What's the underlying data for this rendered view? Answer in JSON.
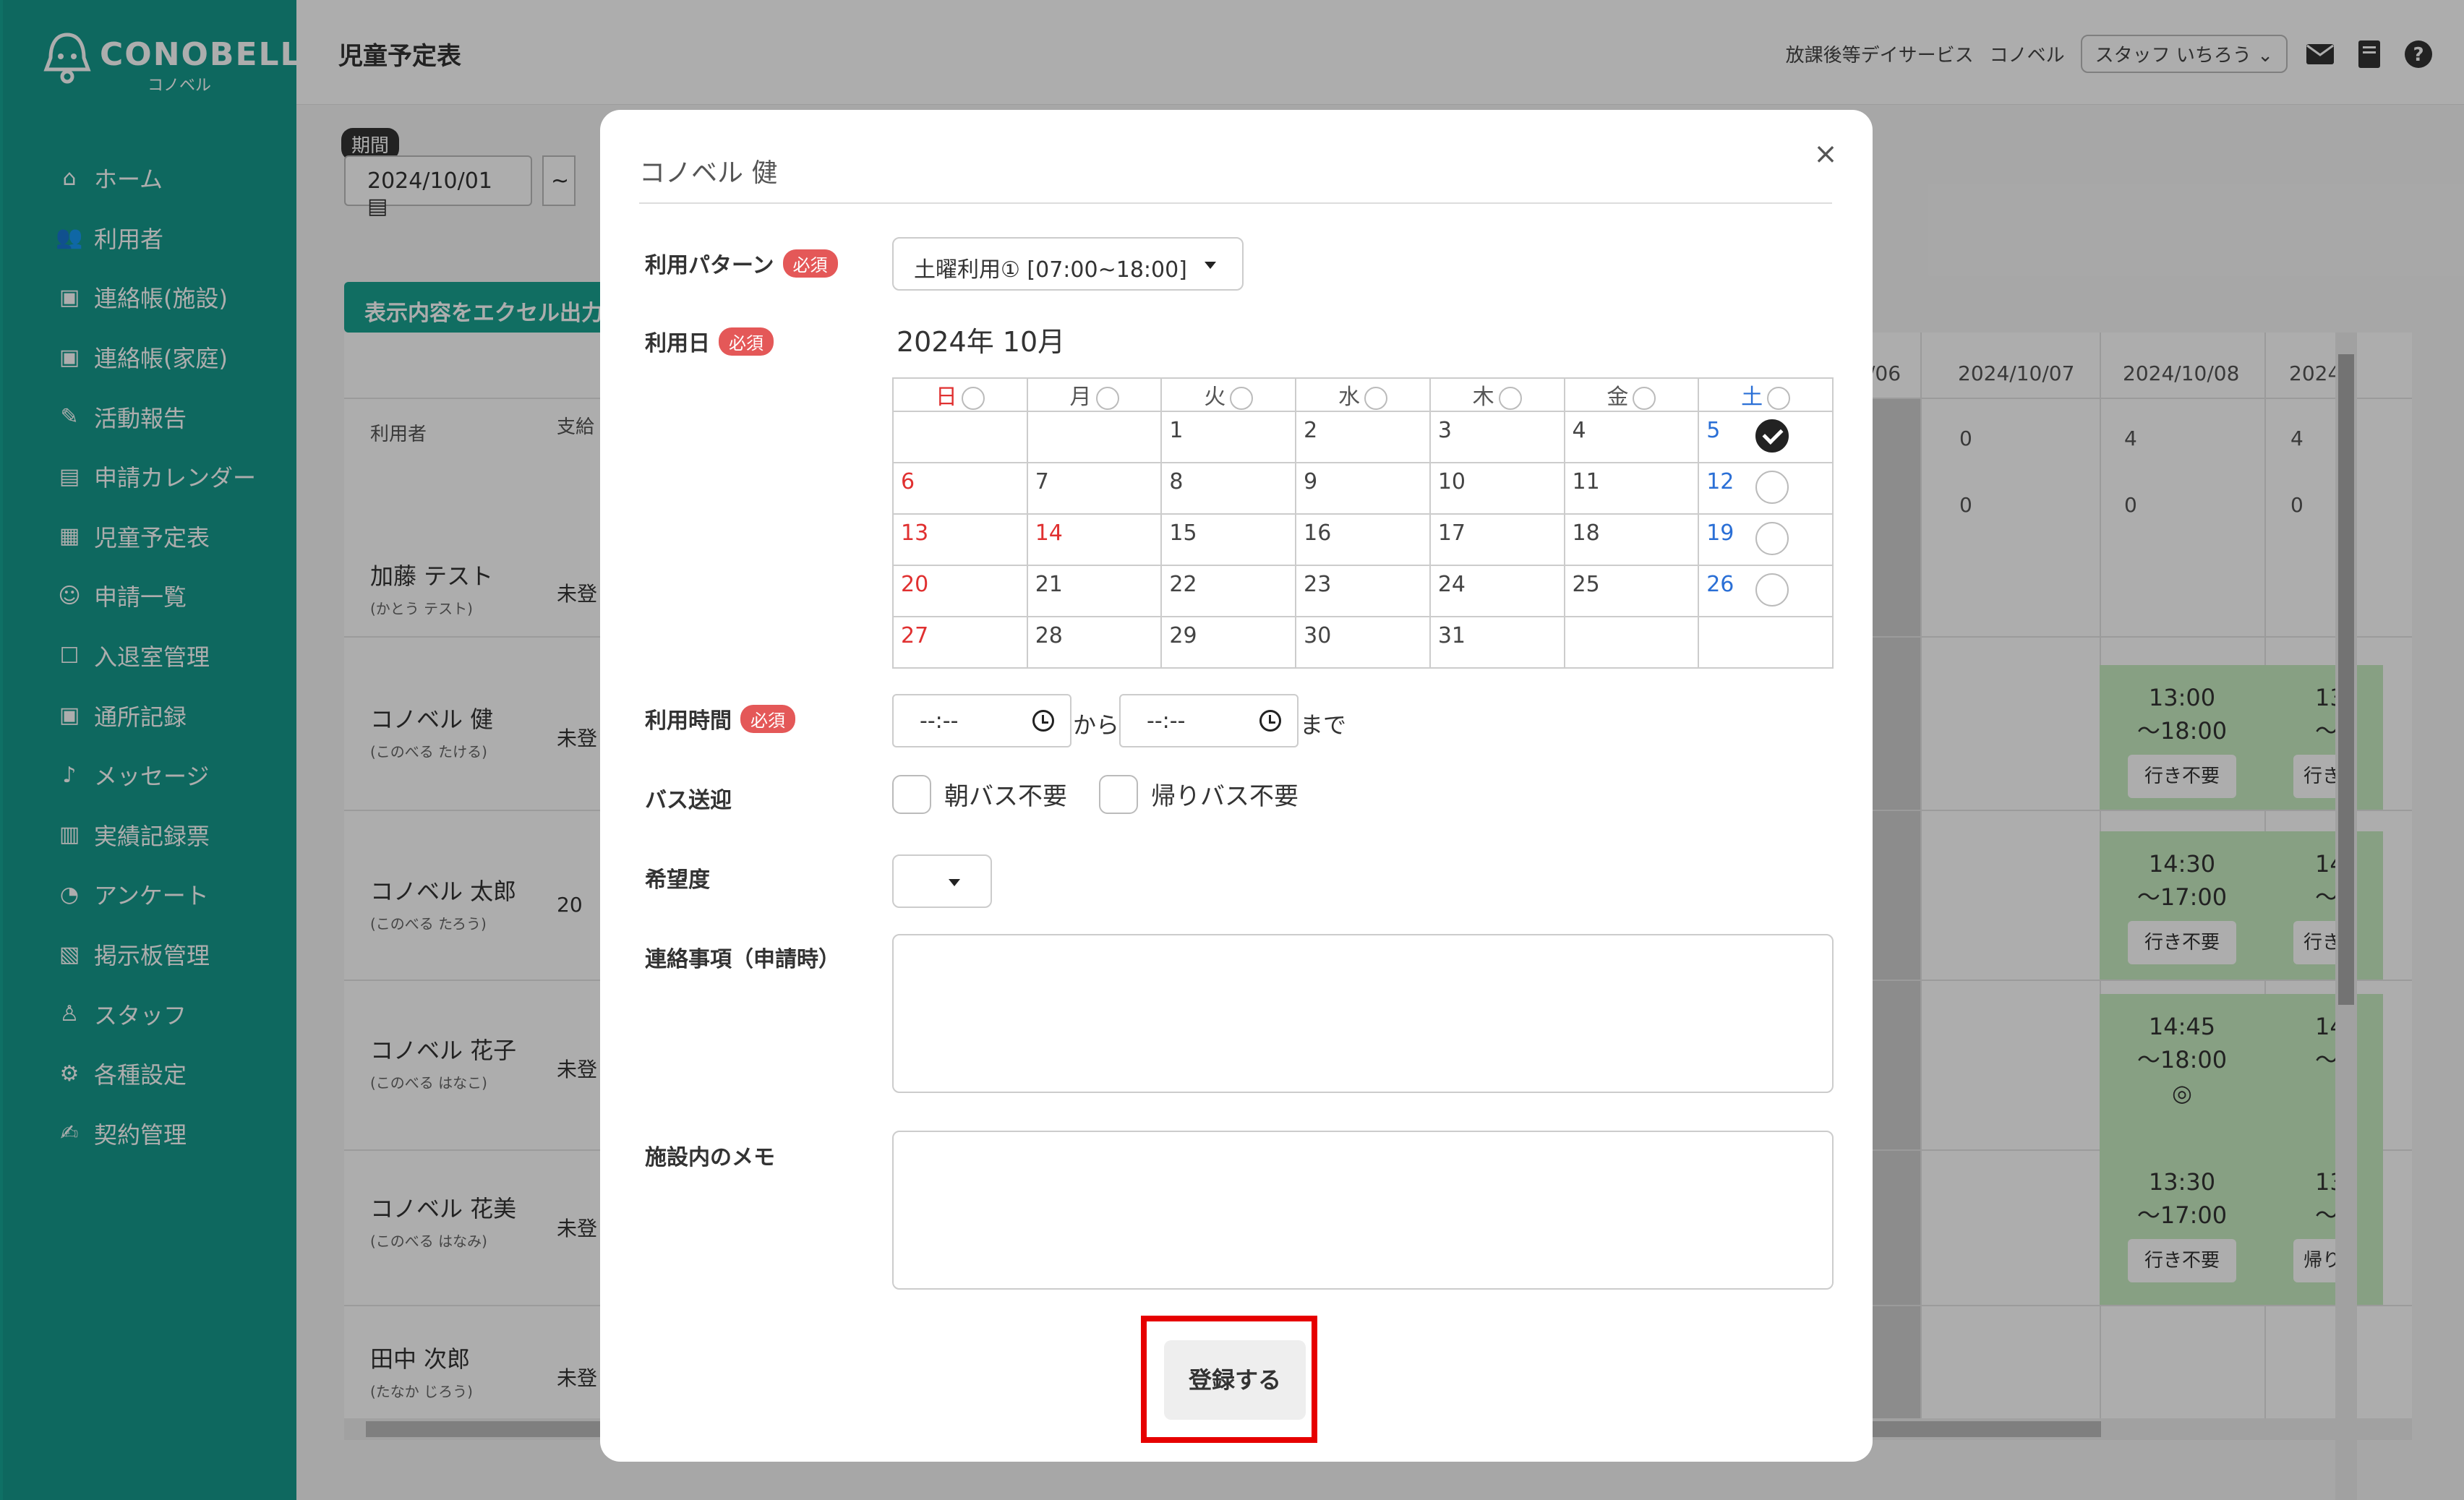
{
  "brand": {
    "name": "CONOBELL",
    "kana": "コノベル"
  },
  "sidebar": {
    "items": [
      {
        "label": "ホーム",
        "icon": "home-icon"
      },
      {
        "label": "利用者",
        "icon": "users-icon"
      },
      {
        "label": "連絡帳(施設)",
        "icon": "notebook-icon"
      },
      {
        "label": "連絡帳(家庭)",
        "icon": "notebook-icon"
      },
      {
        "label": "活動報告",
        "icon": "report-icon"
      },
      {
        "label": "申請カレンダー",
        "icon": "calendar-icon"
      },
      {
        "label": "児童予定表",
        "icon": "building-icon"
      },
      {
        "label": "申請一覧",
        "icon": "child-icon"
      },
      {
        "label": "入退室管理",
        "icon": "door-icon"
      },
      {
        "label": "通所記録",
        "icon": "notebook-icon"
      },
      {
        "label": "メッセージ",
        "icon": "bell-icon"
      },
      {
        "label": "実績記録票",
        "icon": "table-icon"
      },
      {
        "label": "アンケート",
        "icon": "pie-icon"
      },
      {
        "label": "掲示板管理",
        "icon": "board-icon"
      },
      {
        "label": "スタッフ",
        "icon": "staff-icon"
      },
      {
        "label": "各種設定",
        "icon": "gear-icon"
      },
      {
        "label": "契約管理",
        "icon": "contract-icon"
      }
    ]
  },
  "header": {
    "title": "児童予定表",
    "service": "放課後等デイサービス",
    "facility": "コノベル",
    "staff": "スタッフ いちろう"
  },
  "filters": {
    "period_label": "期間",
    "start_date": "2024/10/01",
    "tilde": "~",
    "excel_button": "表示内容をエクセル出力"
  },
  "table": {
    "col_user": "利用者",
    "col_pay": "支給",
    "dates": [
      "/06",
      "2024/10/07",
      "2024/10/08",
      "2024"
    ],
    "summary_row1": [
      "0",
      "4",
      "4"
    ],
    "summary_row2": [
      "0",
      "0",
      "0"
    ],
    "rows": [
      {
        "name": "加藤 テスト",
        "kana": "(かとう テスト)",
        "status": "未登"
      },
      {
        "name": "コノベル 健",
        "kana": "(このべる たける)",
        "status": "未登"
      },
      {
        "name": "コノベル 太郎",
        "kana": "(このべる たろう)",
        "status": "20"
      },
      {
        "name": "コノベル 花子",
        "kana": "(このべる はなこ)",
        "status": "未登"
      },
      {
        "name": "コノベル 花美",
        "kana": "(このべる はなみ)",
        "status": "未登"
      },
      {
        "name": "田中 次郎",
        "kana": "(たなか じろう)",
        "status": "未登"
      }
    ],
    "cells": [
      {
        "time1": "13:00",
        "time2": "〜18:00",
        "btn": "行き不要",
        "cut1": "13",
        "cut2": "〜",
        "cutbtn": "行き"
      },
      {
        "time1": "14:30",
        "time2": "〜17:00",
        "btn": "行き不要",
        "cut1": "14",
        "cut2": "〜",
        "cutbtn": "行き"
      },
      {
        "time1": "14:45",
        "time2": "〜18:00",
        "mark": "◎",
        "cut1": "14",
        "cut2": "〜"
      },
      {
        "time1": "13:30",
        "time2": "〜17:00",
        "btn": "行き不要",
        "cut1": "13",
        "cut2": "〜",
        "cutbtn": "帰り"
      }
    ]
  },
  "modal": {
    "title": "コノベル 健",
    "close": "×",
    "required": "必須",
    "pattern_label": "利用パターン",
    "pattern_value": "土曜利用① [07:00~18:00]",
    "date_label": "利用日",
    "month": "2024年 10月",
    "weekdays": [
      "日",
      "月",
      "火",
      "水",
      "木",
      "金",
      "土"
    ],
    "weeks": [
      [
        "",
        "",
        "1",
        "2",
        "3",
        "4",
        "5"
      ],
      [
        "6",
        "7",
        "8",
        "9",
        "10",
        "11",
        "12"
      ],
      [
        "13",
        "14",
        "15",
        "16",
        "17",
        "18",
        "19"
      ],
      [
        "20",
        "21",
        "22",
        "23",
        "24",
        "25",
        "26"
      ],
      [
        "27",
        "28",
        "29",
        "30",
        "31",
        "",
        ""
      ]
    ],
    "checked_days": [
      "5"
    ],
    "time_label": "利用時間",
    "time_from": "--:--",
    "time_to": "--:--",
    "from_text": "から",
    "to_text": "まで",
    "bus_label": "バス送迎",
    "bus_morning": "朝バス不要",
    "bus_return": "帰りバス不要",
    "hope_label": "希望度",
    "note_label": "連絡事項（申請時）",
    "memo_label": "施設内のメモ",
    "submit": "登録する"
  },
  "colors": {
    "sidebar": "#159a8c",
    "accent": "#1aa391",
    "required": "#e45858",
    "highlight": "#e60000",
    "cell_green": "#c8ecc2"
  }
}
